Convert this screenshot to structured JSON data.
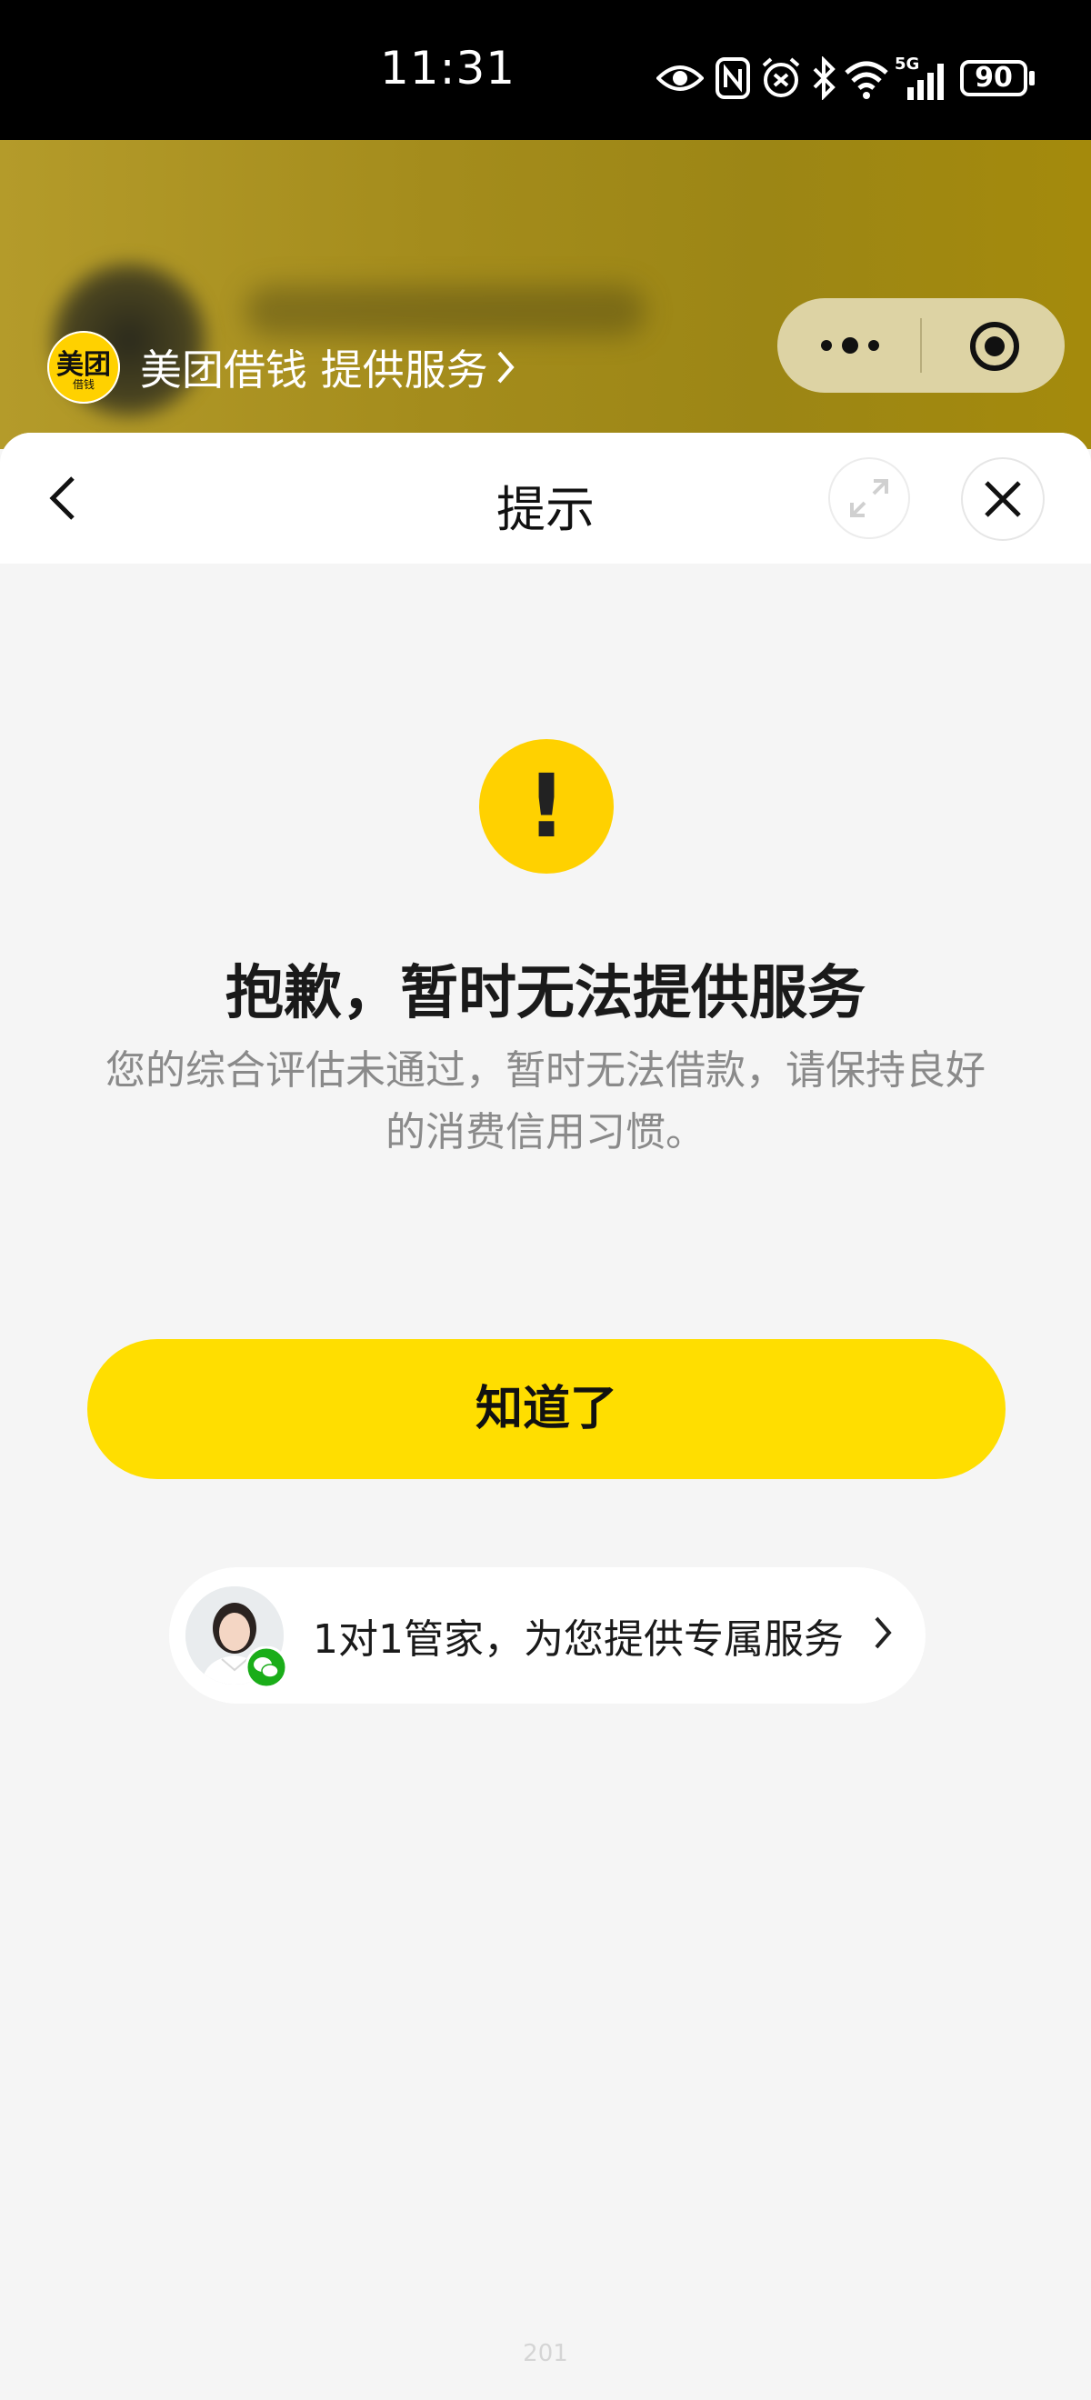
{
  "status_bar": {
    "time": "11:31",
    "battery": "90",
    "network": "5G",
    "icons": [
      "eye-icon",
      "nfc-icon",
      "alarm-icon",
      "bluetooth-icon",
      "wifi-icon",
      "signal-icon",
      "battery-icon"
    ]
  },
  "header": {
    "provider_logo_main": "美团",
    "provider_logo_sub": "借钱",
    "provider_text": "美团借钱 提供服务"
  },
  "navbar": {
    "title": "提示"
  },
  "result": {
    "icon_symbol": "!",
    "title": "抱歉，暂时无法提供服务",
    "description": "您的综合评估未通过，暂时无法借款，请保持良好的消费信用习惯。"
  },
  "actions": {
    "ok_label": "知道了",
    "service_label": "1对1管家，为您提供专属服务"
  },
  "footer": {
    "page_code": "201"
  },
  "colors": {
    "accent": "#ffde00",
    "icon_yellow": "#ffd100",
    "header_bg": "#a48c1c",
    "page_bg": "#f5f5f5",
    "wechat_green": "#1aad19"
  }
}
